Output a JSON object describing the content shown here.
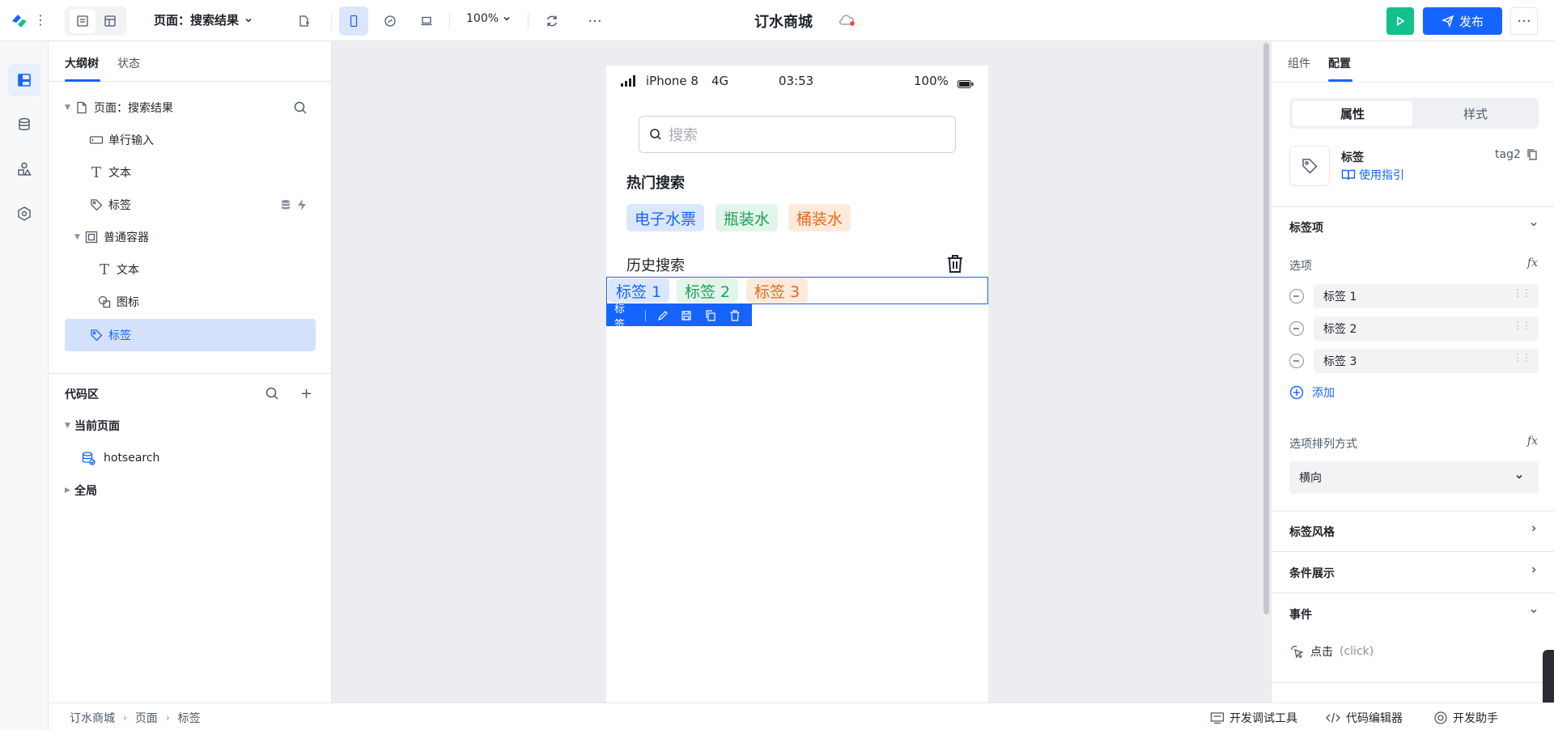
{
  "topbar": {
    "page_select": "页面：搜索结果",
    "zoom": "100%",
    "app_title": "订水商城",
    "publish_label": "发布"
  },
  "left_panel": {
    "tabs": [
      "大纲树",
      "状态"
    ],
    "tree": [
      {
        "label": "页面：搜索结果",
        "icon": "page-icon"
      },
      {
        "label": "单行输入",
        "icon": "input-icon"
      },
      {
        "label": "文本",
        "icon": "text-icon"
      },
      {
        "label": "标签",
        "icon": "tag-icon"
      },
      {
        "label": "普通容器",
        "icon": "container-icon"
      },
      {
        "label": "文本",
        "icon": "text-icon"
      },
      {
        "label": "图标",
        "icon": "shapes-icon"
      },
      {
        "label": "标签",
        "icon": "tag-icon"
      }
    ],
    "code_area": {
      "title": "代码区",
      "current_page": "当前页面",
      "item": "hotsearch",
      "global": "全局"
    }
  },
  "phone": {
    "status": {
      "carrier": "iPhone 8",
      "network": "4G",
      "time": "03:53",
      "battery": "100%"
    },
    "search_placeholder": "搜索",
    "hot_title": "热门搜索",
    "hot_chips": [
      "电子水票",
      "瓶装水",
      "桶装水"
    ],
    "history_title": "历史搜索",
    "history_chips": [
      "标签 1",
      "标签 2",
      "标签 3"
    ],
    "selection_label": "标签"
  },
  "right_panel": {
    "tabs": [
      "组件",
      "配置"
    ],
    "segment": [
      "属性",
      "样式"
    ],
    "component": {
      "name": "标签",
      "id": "tag2",
      "guide": "使用指引"
    },
    "tag_items_title": "标签项",
    "options_label": "选项",
    "options": [
      "标签 1",
      "标签 2",
      "标签 3"
    ],
    "add_label": "添加",
    "layout_label": "选项排列方式",
    "layout_value": "横向",
    "style_title": "标签风格",
    "condition_title": "条件展示",
    "events_title": "事件",
    "event_item": "点击",
    "event_item_code": "(click)"
  },
  "bottombar": {
    "breadcrumb": [
      "订水商城",
      "页面",
      "标签"
    ],
    "debug_tool": "开发调试工具",
    "code_editor": "代码编辑器",
    "dev_assistant": "开发助手"
  },
  "colors": {
    "accent": "#1664ff",
    "run": "#14c08b"
  }
}
